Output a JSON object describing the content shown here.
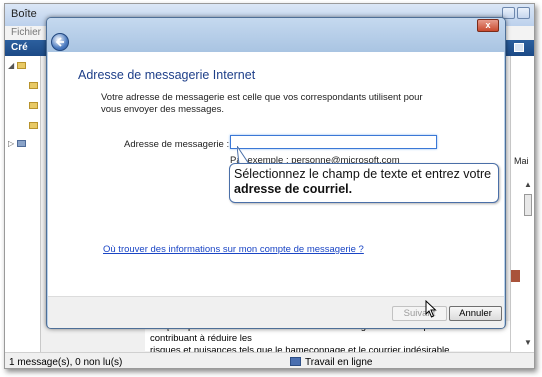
{
  "background_app": {
    "title": "Boîte",
    "menu_label": "Fichier",
    "toolbar_create_label": "Cré",
    "reading_pane_column_label": "Mai",
    "reading_pane_text_line1": "conçues pour enrichir votre utilisation de la messagerie électronique tout en contribuant à réduire les",
    "reading_pane_text_line2": "risques et nuisances tels que le hameçonnage et le courrier indésirable.",
    "status_count": "1 message(s), 0 non lu(s)",
    "status_online": "Travail en ligne"
  },
  "dialog": {
    "close_label": "x",
    "heading": "Adresse de messagerie Internet",
    "description": "Votre adresse de messagerie est celle que vos correspondants utilisent pour vous envoyer des messages.",
    "field_label": "Adresse de messagerie :",
    "field_value": "",
    "example_text": "Par exemple : personne@microsoft.com",
    "help_link": "Où trouver des informations sur mon compte de messagerie ?",
    "next_button": "Suivant",
    "cancel_button": "Annuler"
  },
  "callout": {
    "line1": "Sélectionnez le champ de texte et entrez votre",
    "line2": "adresse de courriel."
  },
  "icons": {
    "back": "back-arrow-icon",
    "close": "close-icon",
    "cursor": "mouse-pointer-icon",
    "folder": "folder-icon",
    "online": "network-online-icon"
  },
  "colors": {
    "heading": "#1e3f89",
    "link": "#1a45c5",
    "dialog_frame": "#b9d1ea",
    "toolbar": "#1c4a86"
  }
}
